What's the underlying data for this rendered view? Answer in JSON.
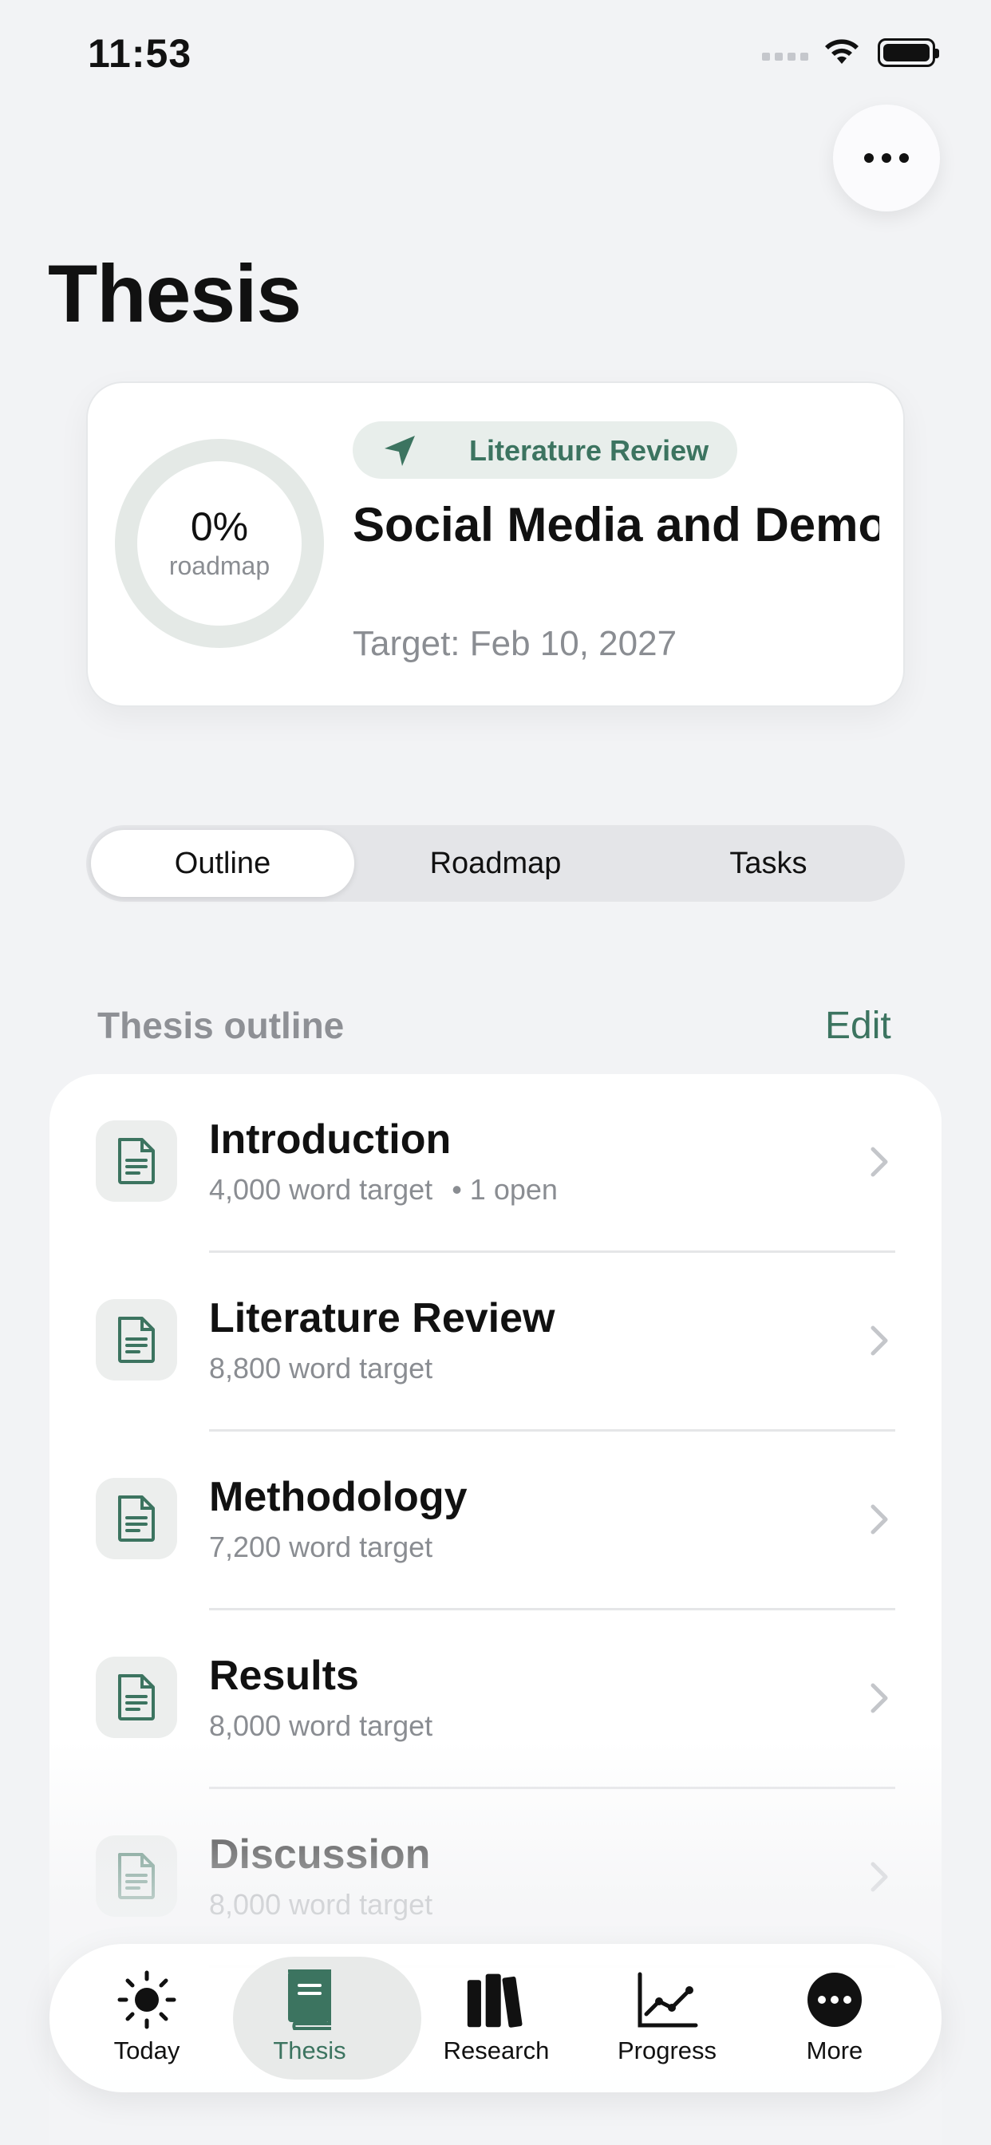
{
  "status": {
    "time": "11:53"
  },
  "page": {
    "title": "Thesis"
  },
  "hero": {
    "progress_pct": "0%",
    "progress_label": "roadmap",
    "progress_value": 0,
    "phase": "Literature Review",
    "phase_icon": "location-arrow-icon",
    "title": "Social Media and Democratic Partici...",
    "target": "Target: Feb 10, 2027"
  },
  "segments": [
    {
      "label": "Outline",
      "active": true
    },
    {
      "label": "Roadmap",
      "active": false
    },
    {
      "label": "Tasks",
      "active": false
    }
  ],
  "outline": {
    "title": "Thesis outline",
    "edit_label": "Edit",
    "items": [
      {
        "title": "Introduction",
        "subtitle": "4,000 word target",
        "extra": "• 1 open"
      },
      {
        "title": "Literature Review",
        "subtitle": "8,800 word target",
        "extra": ""
      },
      {
        "title": "Methodology",
        "subtitle": "7,200 word target",
        "extra": ""
      },
      {
        "title": "Results",
        "subtitle": "8,000 word target",
        "extra": ""
      },
      {
        "title": "Discussion",
        "subtitle": "8,000 word target",
        "extra": ""
      }
    ]
  },
  "tabbar": [
    {
      "label": "Today",
      "icon": "sun-icon",
      "active": false
    },
    {
      "label": "Thesis",
      "icon": "book-icon",
      "active": true
    },
    {
      "label": "Research",
      "icon": "library-icon",
      "active": false
    },
    {
      "label": "Progress",
      "icon": "chart-line-icon",
      "active": false
    },
    {
      "label": "More",
      "icon": "ellipsis-circle-icon",
      "active": false
    }
  ],
  "colors": {
    "accent": "#3c7460",
    "background": "#f2f3f5",
    "ring_track": "#e4e9e6"
  }
}
